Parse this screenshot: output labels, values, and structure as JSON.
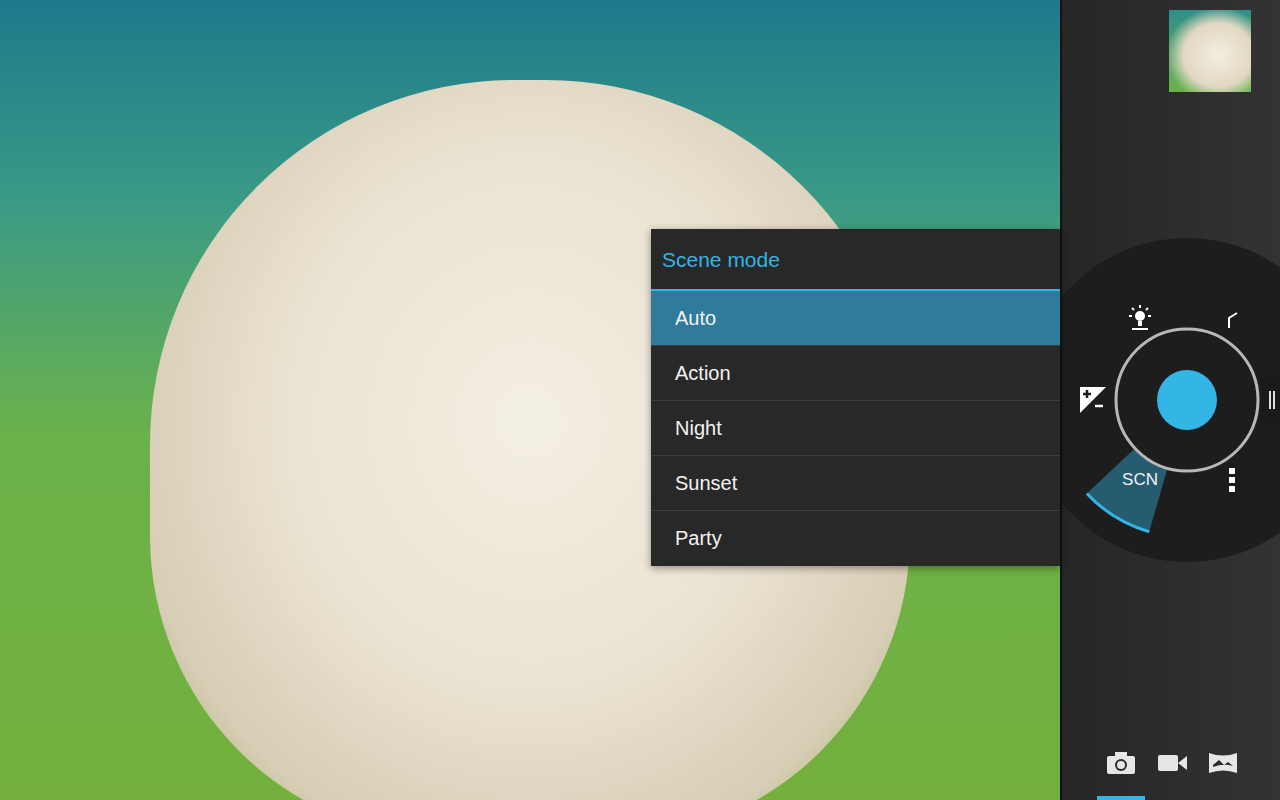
{
  "scene_menu": {
    "title": "Scene mode",
    "items": [
      {
        "label": "Auto",
        "selected": true
      },
      {
        "label": "Action",
        "selected": false
      },
      {
        "label": "Night",
        "selected": false
      },
      {
        "label": "Sunset",
        "selected": false
      },
      {
        "label": "Party",
        "selected": false
      }
    ]
  },
  "control_ring": {
    "settings": [
      {
        "kind": "white-balance",
        "selected": false
      },
      {
        "kind": "flash",
        "selected": false
      },
      {
        "kind": "exposure",
        "selected": false
      },
      {
        "kind": "scene",
        "label": "SCN",
        "selected": true
      },
      {
        "kind": "more",
        "selected": false
      }
    ]
  },
  "mode_switcher": [
    {
      "kind": "photo",
      "selected": true
    },
    {
      "kind": "video",
      "selected": false
    },
    {
      "kind": "panorama",
      "selected": false
    }
  ]
}
